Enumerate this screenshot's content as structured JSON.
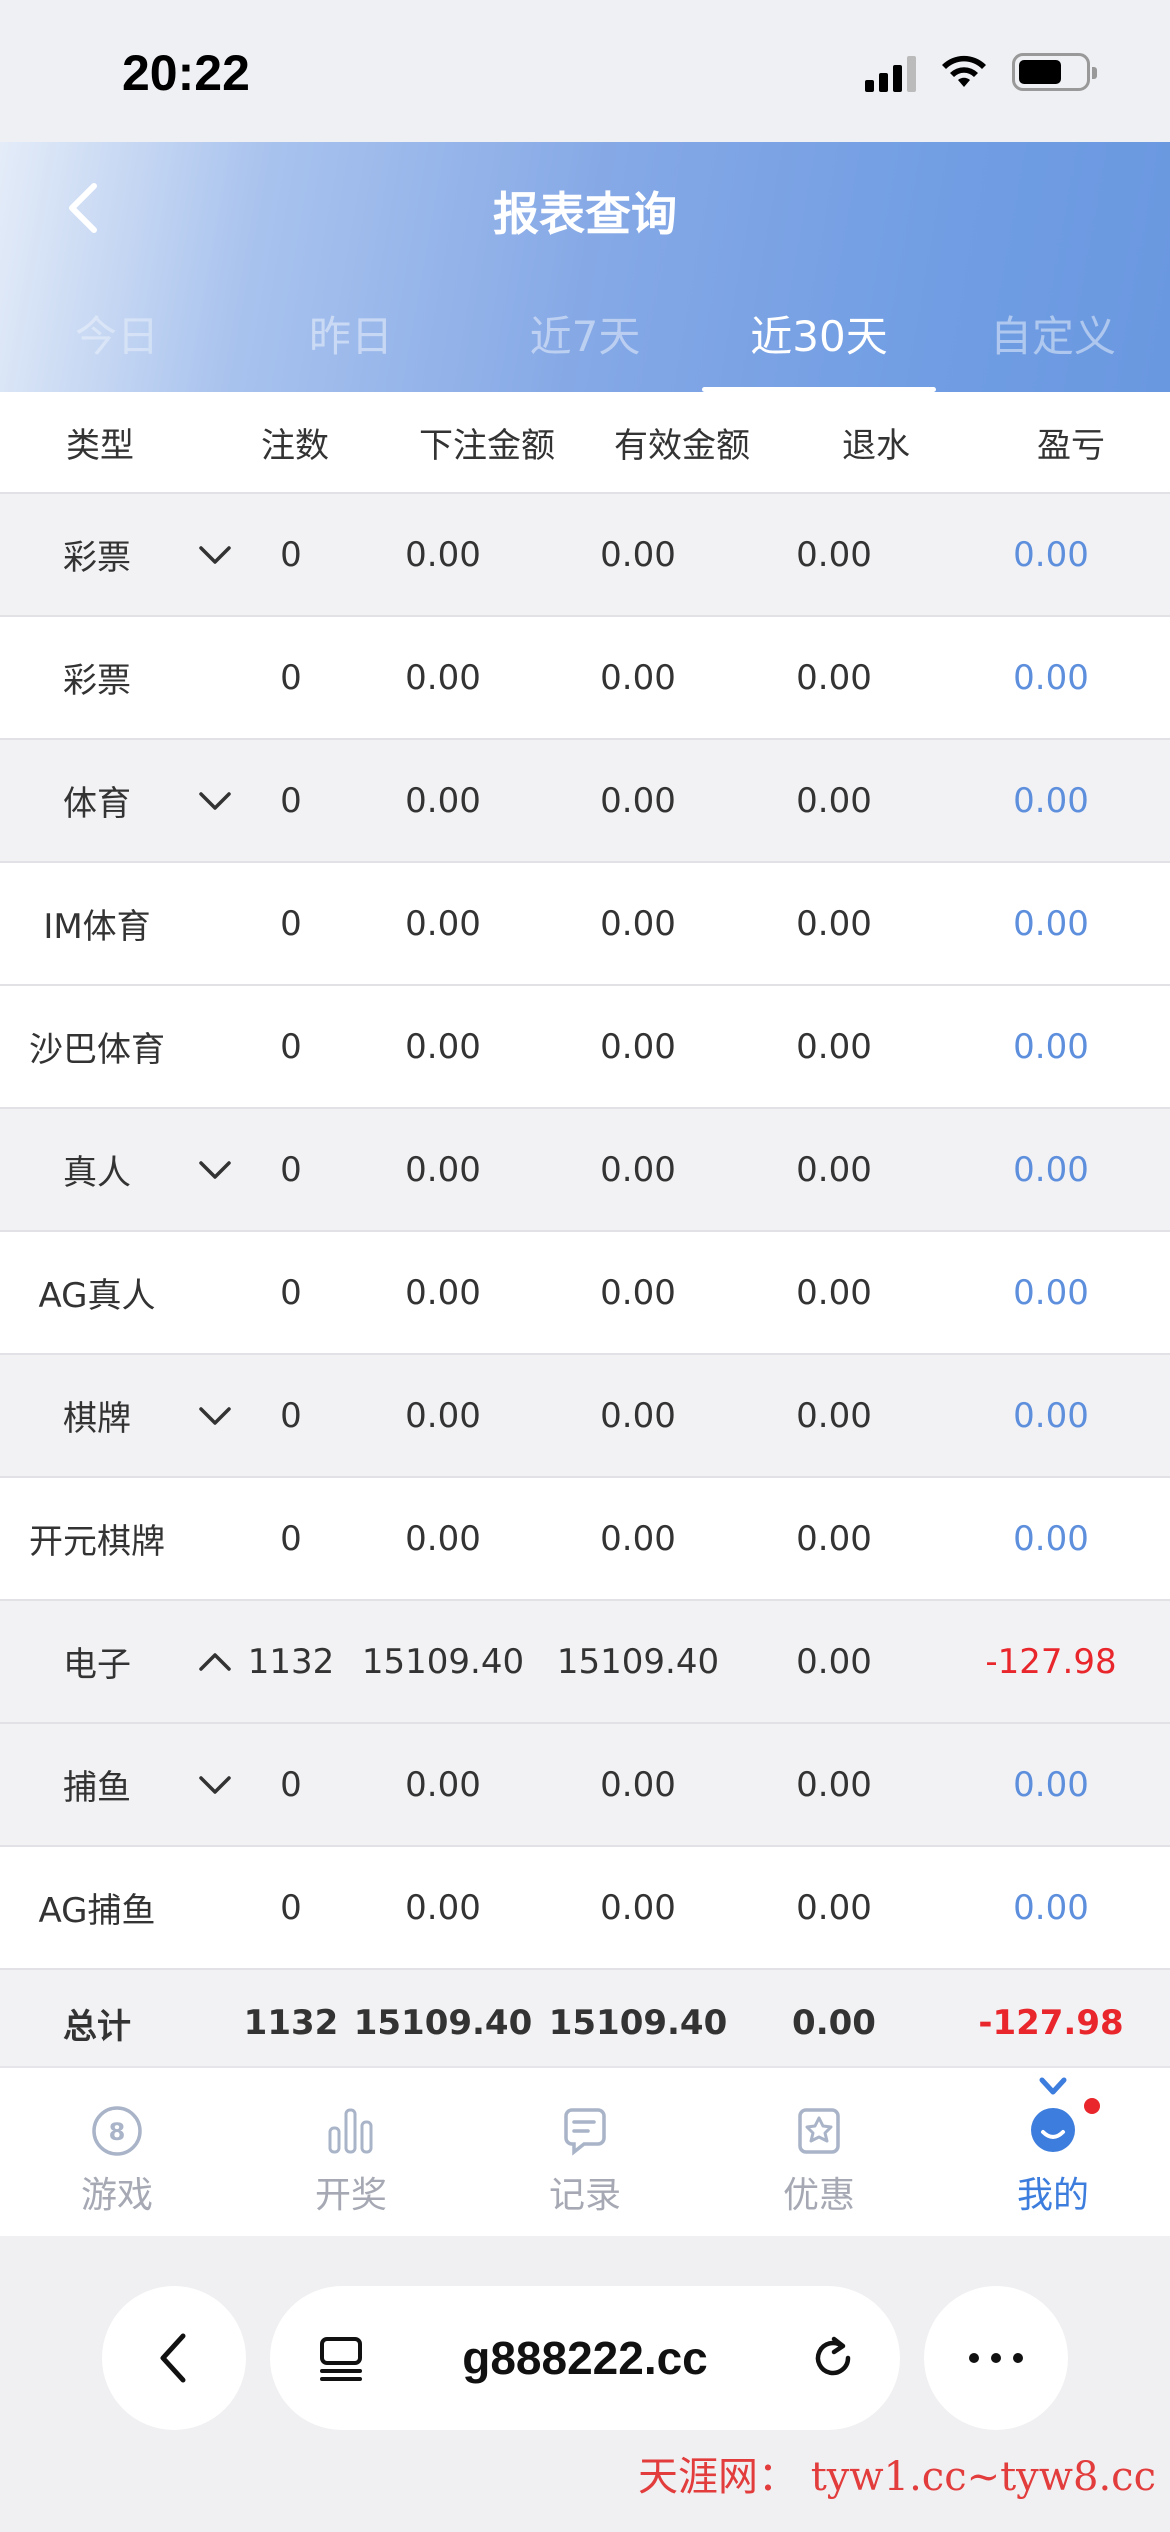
{
  "status": {
    "time": "20:22"
  },
  "header": {
    "title": "报表查询",
    "tabs": [
      "今日",
      "昨日",
      "近7天",
      "近30天",
      "自定义"
    ],
    "active_tab": 3
  },
  "table": {
    "columns": [
      "类型",
      "注数",
      "下注金额",
      "有效金额",
      "退水",
      "盈亏"
    ],
    "rows": [
      {
        "kind": "group",
        "type": "彩票",
        "expanded": false,
        "count": "0",
        "bet": "0.00",
        "valid": "0.00",
        "rebate": "0.00",
        "pl": "0.00"
      },
      {
        "kind": "item",
        "type": "彩票",
        "count": "0",
        "bet": "0.00",
        "valid": "0.00",
        "rebate": "0.00",
        "pl": "0.00"
      },
      {
        "kind": "group",
        "type": "体育",
        "expanded": false,
        "count": "0",
        "bet": "0.00",
        "valid": "0.00",
        "rebate": "0.00",
        "pl": "0.00"
      },
      {
        "kind": "item",
        "type": "IM体育",
        "count": "0",
        "bet": "0.00",
        "valid": "0.00",
        "rebate": "0.00",
        "pl": "0.00"
      },
      {
        "kind": "item",
        "type": "沙巴体育",
        "count": "0",
        "bet": "0.00",
        "valid": "0.00",
        "rebate": "0.00",
        "pl": "0.00"
      },
      {
        "kind": "group",
        "type": "真人",
        "expanded": false,
        "count": "0",
        "bet": "0.00",
        "valid": "0.00",
        "rebate": "0.00",
        "pl": "0.00"
      },
      {
        "kind": "item",
        "type": "AG真人",
        "count": "0",
        "bet": "0.00",
        "valid": "0.00",
        "rebate": "0.00",
        "pl": "0.00"
      },
      {
        "kind": "group",
        "type": "棋牌",
        "expanded": false,
        "count": "0",
        "bet": "0.00",
        "valid": "0.00",
        "rebate": "0.00",
        "pl": "0.00"
      },
      {
        "kind": "item",
        "type": "开元棋牌",
        "count": "0",
        "bet": "0.00",
        "valid": "0.00",
        "rebate": "0.00",
        "pl": "0.00"
      },
      {
        "kind": "group",
        "type": "电子",
        "expanded": true,
        "count": "1132",
        "bet": "15109.40",
        "valid": "15109.40",
        "rebate": "0.00",
        "pl": "-127.98"
      },
      {
        "kind": "group",
        "type": "捕鱼",
        "expanded": false,
        "count": "0",
        "bet": "0.00",
        "valid": "0.00",
        "rebate": "0.00",
        "pl": "0.00"
      },
      {
        "kind": "item",
        "type": "AG捕鱼",
        "count": "0",
        "bet": "0.00",
        "valid": "0.00",
        "rebate": "0.00",
        "pl": "0.00"
      }
    ],
    "total": {
      "type": "总计",
      "count": "1132",
      "bet": "15109.40",
      "valid": "15109.40",
      "rebate": "0.00",
      "pl": "-127.98"
    }
  },
  "nav": {
    "items": [
      {
        "label": "游戏",
        "icon": "game-icon"
      },
      {
        "label": "开奖",
        "icon": "chart-icon"
      },
      {
        "label": "记录",
        "icon": "record-icon"
      },
      {
        "label": "优惠",
        "icon": "promo-icon"
      },
      {
        "label": "我的",
        "icon": "profile-icon"
      }
    ],
    "active": 4
  },
  "browser": {
    "url": "g888222.cc"
  },
  "watermark": "天涯网： tyw1.cc~tyw8.cc",
  "colors": {
    "profit_positive": "#5d8fdd",
    "loss": "#e8262b",
    "active": "#3d7ddd"
  }
}
